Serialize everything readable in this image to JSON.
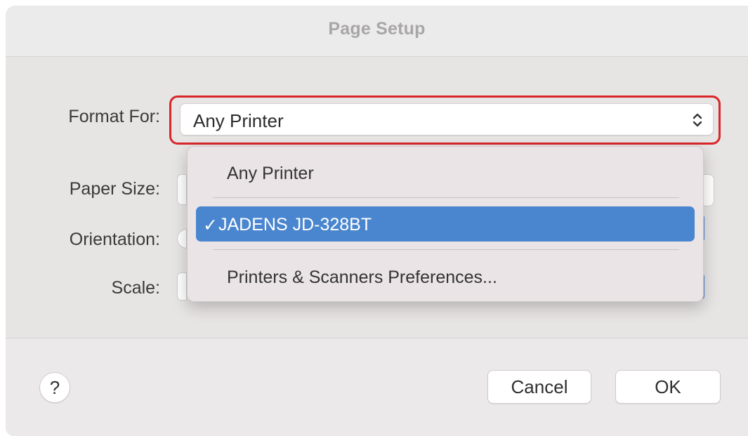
{
  "dialog": {
    "title": "Page Setup"
  },
  "form": {
    "format_for_label": "Format For:",
    "format_for_value": "Any Printer",
    "paper_size_label": "Paper Size:",
    "orientation_label": "Orientation:",
    "scale_label": "Scale:"
  },
  "menu": {
    "items": [
      {
        "label": "Any Printer",
        "selected": false
      },
      {
        "label": "JADENS JD-328BT",
        "selected": true,
        "check": "✓"
      },
      {
        "label": "Printers & Scanners Preferences...",
        "selected": false
      }
    ]
  },
  "footer": {
    "help_label": "?",
    "cancel_label": "Cancel",
    "ok_label": "OK"
  },
  "colors": {
    "highlight_border": "#d9262b",
    "selected_item_bg": "#4a86cf",
    "dialog_bg": "#e9e6e6"
  },
  "icons": {
    "popup": "chevron-up-down-icon",
    "check": "checkmark-icon"
  }
}
